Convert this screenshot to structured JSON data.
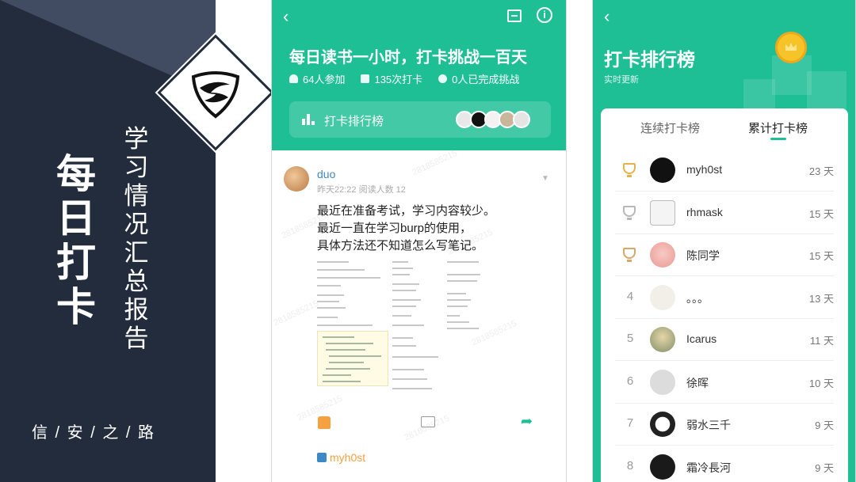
{
  "banner": {
    "title": "每日打卡",
    "subtitle": "学习情况汇总报告",
    "slogan": "信 / 安 / 之 / 路"
  },
  "checkin_page": {
    "title": "每日读书一小时，打卡挑战一百天",
    "stats": {
      "participants": "64人参加",
      "checkins": "135次打卡",
      "completed": "0人已完成挑战"
    },
    "leaderboard_label": "打卡排行榜",
    "post": {
      "author": "duo",
      "meta": "昨天22:22  阅读人数 12",
      "lines": [
        "最近在准备考试，学习内容较少。",
        "最近一直在学习burp的使用，",
        "具体方法还不知道怎么写笔记。"
      ],
      "liked_by": "myh0st"
    },
    "watermark": "2818585215"
  },
  "leaderboard": {
    "title": "打卡排行榜",
    "subtitle": "实时更新",
    "tabs": [
      "连续打卡榜",
      "累计打卡榜"
    ],
    "active_tab": 1,
    "entries": [
      {
        "rank": "1",
        "name": "myh0st",
        "days": "23 天",
        "trophy": "gold"
      },
      {
        "rank": "2",
        "name": "rhmask",
        "days": "15 天",
        "trophy": "silver"
      },
      {
        "rank": "3",
        "name": "陈同学",
        "days": "15 天",
        "trophy": "bronze"
      },
      {
        "rank": "4",
        "name": "。。。",
        "days": "13 天"
      },
      {
        "rank": "5",
        "name": "Icarus",
        "days": "11 天"
      },
      {
        "rank": "6",
        "name": "徐晖",
        "days": "10 天"
      },
      {
        "rank": "7",
        "name": "弱水三千",
        "days": "9 天"
      },
      {
        "rank": "8",
        "name": "霜冷長河",
        "days": "9 天"
      }
    ]
  },
  "colors": {
    "brand_green": "#1fbf96",
    "banner_navy": "#232c3d",
    "link_blue": "#3e89c5",
    "like_orange": "#f5a141",
    "gold": "#e7b24a",
    "silver": "#b8b8b8",
    "bronze": "#d9a66a"
  }
}
